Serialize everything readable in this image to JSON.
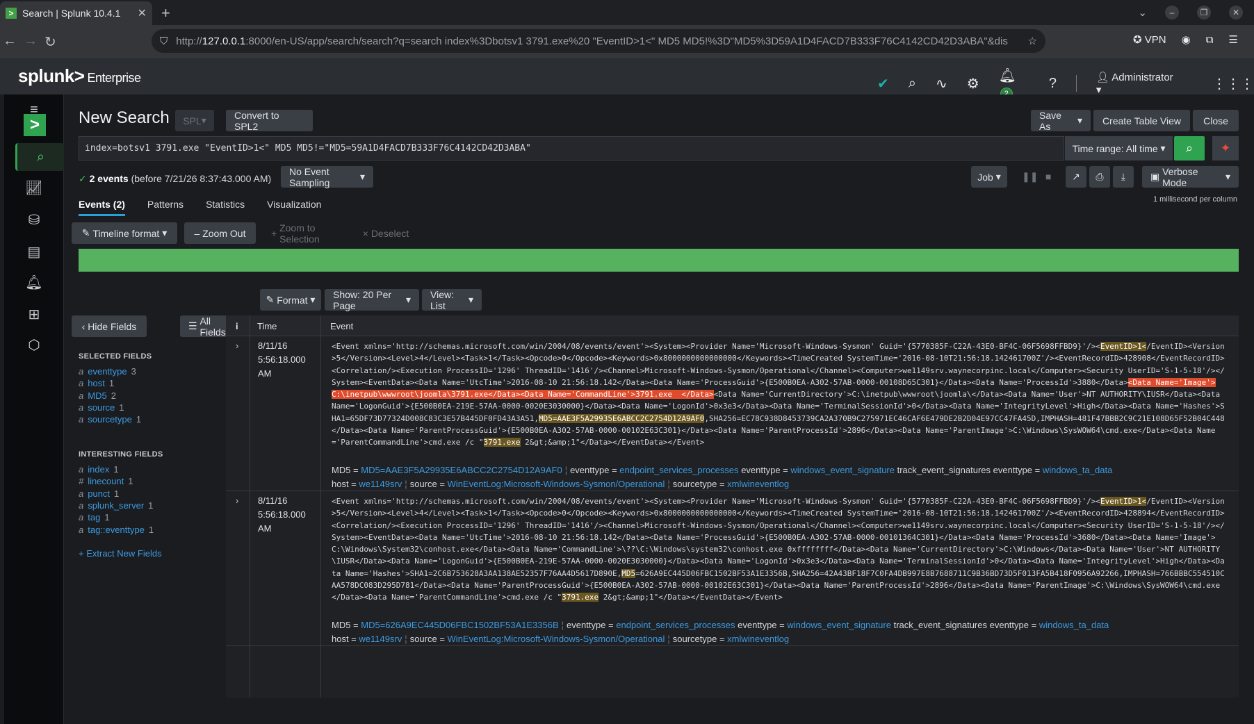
{
  "browser": {
    "tab_title": "Search | Splunk 10.4.1",
    "url_prefix": "http://",
    "url_host": "127.0.0.1",
    "url_rest": ":8000/en-US/app/search/search?q=search index%3Dbotsv1 3791.exe%20 \"EventID>1<\" MD5 MD5!%3D\"MD5%3D59A1D4FACD7B333F76C4142CD42D3ABA\"&dis",
    "vpn_label": "VPN"
  },
  "splunk": {
    "logo_main": "splunk>",
    "logo_suffix": "Enterprise",
    "notif_count": "2",
    "user": "Administrator"
  },
  "search": {
    "title": "New Search",
    "spl_btn": "SPL",
    "convert_btn": "Convert to SPL2",
    "save_as": "Save As",
    "create_table": "Create Table View",
    "close": "Close",
    "query": "index=botsv1 3791.exe  \"EventID>1<\" MD5 MD5!=\"MD5=59A1D4FACD7B333F76C4142CD42D3ABA\"",
    "time_range": "Time range: All time",
    "count_bold": "2 events",
    "count_rest": "(before 7/21/26 8:37:43.000 AM)",
    "sampling": "No Event Sampling",
    "job": "Job",
    "mode": "Verbose Mode"
  },
  "tabs": [
    "Events (2)",
    "Patterns",
    "Statistics",
    "Visualization"
  ],
  "timeline": {
    "format": "Timeline format",
    "zoom_out": "Zoom Out",
    "zoom_sel": "Zoom to Selection",
    "deselect": "Deselect",
    "rate": "1 millisecond per column"
  },
  "results_controls": {
    "format": "Format",
    "per_page": "Show: 20 Per Page",
    "view": "View: List"
  },
  "fields": {
    "hide": "Hide Fields",
    "all": "All Fields",
    "selected_title": "SELECTED FIELDS",
    "selected": [
      {
        "type": "a",
        "name": "eventtype",
        "count": "3"
      },
      {
        "type": "a",
        "name": "host",
        "count": "1"
      },
      {
        "type": "a",
        "name": "MD5",
        "count": "2"
      },
      {
        "type": "a",
        "name": "source",
        "count": "1"
      },
      {
        "type": "a",
        "name": "sourcetype",
        "count": "1"
      }
    ],
    "interesting_title": "INTERESTING FIELDS",
    "interesting": [
      {
        "type": "a",
        "name": "index",
        "count": "1"
      },
      {
        "type": "#",
        "name": "linecount",
        "count": "1"
      },
      {
        "type": "a",
        "name": "punct",
        "count": "1"
      },
      {
        "type": "a",
        "name": "splunk_server",
        "count": "1"
      },
      {
        "type": "a",
        "name": "tag",
        "count": "1"
      },
      {
        "type": "a",
        "name": "tag::eventtype",
        "count": "1"
      }
    ],
    "extract": "+ Extract New Fields"
  },
  "table": {
    "col_i": "i",
    "col_time": "Time",
    "col_event": "Event"
  },
  "events": [
    {
      "date": "8/11/16",
      "time": "5:56:18.000 AM",
      "parts": [
        {
          "t": "<Event xmlns='http://schemas.microsoft.com/win/2004/08/events/event'><System><Provider Name='Microsoft-Windows-Sysmon' Guid='{5770385F-C22A-43E0-BF4C-06F5698FFBD9}'/><"
        },
        {
          "t": "EventID>1<",
          "h": "y"
        },
        {
          "t": "/EventID><Version>5</Version><Level>4</Level><Task>1</Task><Opcode>0</Opcode><Keywords>0x8000000000000000</Keywords><TimeCreated SystemTime='2016-08-10T21:56:18.142461700Z'/><EventRecordID>428908</EventRecordID><Correlation/><Execution ProcessID='1296' ThreadID='1416'/><Channel>Microsoft-Windows-Sysmon/Operational</Channel><Computer>we1149srv.waynecorpinc.local</Computer><Security UserID='S-1-5-18'/></System><EventData><Data Name='UtcTime'>2016-08-10 21:56:18.142</Data><Data Name='ProcessGuid'>{E500B0EA-A302-57AB-0000-00108D65C301}</Data><Data Name='ProcessId'>3880</Data>"
        },
        {
          "t": "<Data Name='Image'>C:\\inetpub\\wwwroot\\joomla\\3791.exe</Data><Data Name='CommandLine'>3791.exe  </Data>",
          "h": "r"
        },
        {
          "t": "<Data Name='CurrentDirectory'>C:\\inetpub\\wwwroot\\joomla\\</Data><Data Name='User'>NT AUTHORITY\\IUSR</Data><Data Name='LogonGuid'>{E500B0EA-219E-57AA-0000-0020E3030000}</Data><Data Name='LogonId'>0x3e3</Data><Data Name='TerminalSessionId'>0</Data><Data Name='IntegrityLevel'>High</Data><Data Name='Hashes'>SHA1=65DF73D77324D008C83C3E57B445DF0FD43A3A51,"
        },
        {
          "t": "MD5=AAE3F5A29935E6ABCC2C2754D12A9AF0",
          "h": "y"
        },
        {
          "t": ",SHA256=EC78C938D8453739CA2A370B9C275971EC46CAF6E479DE2B2D04E97CC47FA45D,IMPHASH=481F47BBB2C9C21E108D65F52B04C448</Data><Data Name='ParentProcessGuid'>{E500B0EA-A302-57AB-0000-00102E63C301}</Data><Data Name='ParentProcessId'>2896</Data><Data Name='ParentImage'>C:\\Windows\\SysWOW64\\cmd.exe</Data><Data Name='ParentCommandLine'>cmd.exe /c \""
        },
        {
          "t": "3791.exe",
          "h": "y"
        },
        {
          "t": " 2&gt;&amp;1\"</Data></EventData></Event>"
        }
      ],
      "md5": "MD5=AAE3F5A29935E6ABCC2C2754D12A9AF0",
      "eventtypes": [
        "endpoint_services_processes",
        "windows_event_signature",
        "windows_ta_data"
      ],
      "eventtype_mid": "track_event_signatures",
      "host": "we1149srv",
      "source": "WinEventLog:Microsoft-Windows-Sysmon/Operational",
      "sourcetype": "xmlwineventlog"
    },
    {
      "date": "8/11/16",
      "time": "5:56:18.000 AM",
      "parts": [
        {
          "t": "<Event xmlns='http://schemas.microsoft.com/win/2004/08/events/event'><System><Provider Name='Microsoft-Windows-Sysmon' Guid='{5770385F-C22A-43E0-BF4C-06F5698FFBD9}'/><"
        },
        {
          "t": "EventID>1<",
          "h": "y"
        },
        {
          "t": "/EventID><Version>5</Version><Level>4</Level><Task>1</Task><Opcode>0</Opcode><Keywords>0x8000000000000000</Keywords><TimeCreated SystemTime='2016-08-10T21:56:18.142461700Z'/><EventRecordID>428894</EventRecordID><Correlation/><Execution ProcessID='1296' ThreadID='1416'/><Channel>Microsoft-Windows-Sysmon/Operational</Channel><Computer>we1149srv.waynecorpinc.local</Computer><Security UserID='S-1-5-18'/></System><EventData><Data Name='UtcTime'>2016-08-10 21:56:18.142</Data><Data Name='ProcessGuid'>{E500B0EA-A302-57AB-0000-00101364C301}</Data><Data Name='ProcessId'>3680</Data><Data Name='Image'>C:\\Windows\\System32\\conhost.exe</Data><Data Name='CommandLine'>\\??\\C:\\Windows\\system32\\conhost.exe 0xffffffff</Data><Data Name='CurrentDirectory'>C:\\Windows</Data><Data Name='User'>NT AUTHORITY\\IUSR</Data><Data Name='LogonGuid'>{E500B0EA-219E-57AA-0000-0020E3030000}</Data><Data Name='LogonId'>0x3e3</Data><Data Name='TerminalSessionId'>0</Data><Data Name='IntegrityLevel'>High</Data><Data Name='Hashes'>SHA1=2C6B753628A3AA138AE52357F76AA4D5617D890E,"
        },
        {
          "t": "MD5",
          "h": "y"
        },
        {
          "t": "=626A9EC445D06FBC1502BF53A1E3356B,SHA256=42A43BF18F7C0FA4DB997E8B7688711C9B36BD73D5F013FA5B418F0956A92266,IMPHASH=766BBBC554510CAA578DC083D295D781</Data><Data Name='ParentProcessGuid'>{E500B0EA-A302-57AB-0000-00102E63C301}</Data><Data Name='ParentProcessId'>2896</Data><Data Name='ParentImage'>C:\\Windows\\SysWOW64\\cmd.exe</Data><Data Name='ParentCommandLine'>cmd.exe /c \""
        },
        {
          "t": "3791.exe",
          "h": "y"
        },
        {
          "t": " 2&gt;&amp;1\"</Data></EventData></Event>"
        }
      ],
      "md5": "MD5=626A9EC445D06FBC1502BF53A1E3356B",
      "eventtypes": [
        "endpoint_services_processes",
        "windows_event_signature",
        "windows_ta_data"
      ],
      "eventtype_mid": "track_event_signatures",
      "host": "we1149srv",
      "source": "WinEventLog:Microsoft-Windows-Sysmon/Operational",
      "sourcetype": "xmlwineventlog"
    }
  ]
}
